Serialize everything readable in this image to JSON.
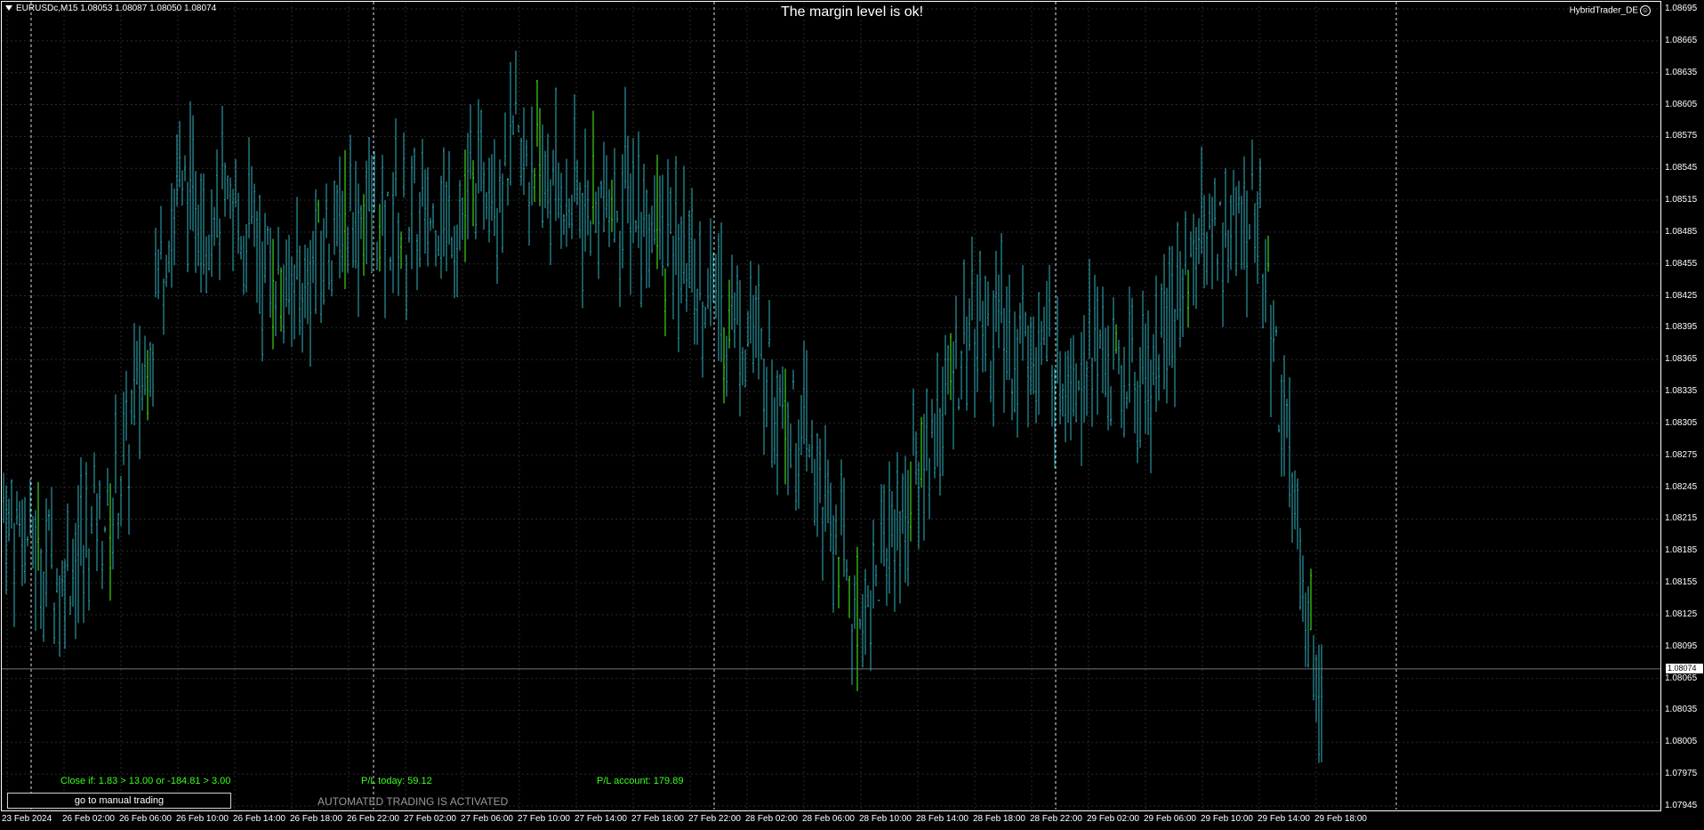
{
  "window": {
    "symbol_info": "EURUSDc,M15  1.08053 1.08087 1.08050 1.08074",
    "margin_message": "The margin level is ok!",
    "ea_name": "HybridTrader_DE"
  },
  "panel": {
    "close_if": "Close if: 1.83 > 13.00 or -184.81 > 3.00",
    "pl_today": "P/L today:  59.12",
    "pl_account": "P/L account:  179.89",
    "manual_button_label": "go to manual trading",
    "automated_status": "AUTOMATED TRADING IS ACTIVATED"
  },
  "colors": {
    "background": "#000000",
    "bar": "#2fb3c0",
    "bar_up": "#4cff1a",
    "grid": "#2a2a2a",
    "separator": "#e0e0e0",
    "axis": "#ffffff",
    "status_text": "#3cff1f"
  },
  "chart_data": {
    "type": "bar",
    "symbol": "EURUSDc",
    "timeframe": "M15",
    "current_price": "1.08074",
    "ylim": [
      1.07945,
      1.08695
    ],
    "y_ticks": [
      "1.08695",
      "1.08665",
      "1.08635",
      "1.08605",
      "1.08575",
      "1.08545",
      "1.08515",
      "1.08485",
      "1.08455",
      "1.08425",
      "1.08395",
      "1.08365",
      "1.08335",
      "1.08305",
      "1.08275",
      "1.08245",
      "1.08215",
      "1.08185",
      "1.08155",
      "1.08125",
      "1.08095",
      "1.08065",
      "1.08035",
      "1.08005",
      "1.07975",
      "1.07945"
    ],
    "x_ticks": [
      "23 Feb 2024",
      "26 Feb 02:00",
      "26 Feb 06:00",
      "26 Feb 10:00",
      "26 Feb 14:00",
      "26 Feb 18:00",
      "26 Feb 22:00",
      "27 Feb 02:00",
      "27 Feb 06:00",
      "27 Feb 10:00",
      "27 Feb 14:00",
      "27 Feb 18:00",
      "27 Feb 22:00",
      "28 Feb 02:00",
      "28 Feb 06:00",
      "28 Feb 10:00",
      "28 Feb 14:00",
      "28 Feb 18:00",
      "28 Feb 22:00",
      "29 Feb 02:00",
      "29 Feb 06:00",
      "29 Feb 10:00",
      "29 Feb 14:00",
      "29 Feb 18:00"
    ],
    "day_separators": [
      "26 Feb 00:00",
      "26 Feb 24:00",
      "27 Feb 24:00",
      "28 Feb 24:00",
      "29 Feb 24:00"
    ],
    "series": [
      {
        "x": [
          "23 Feb 2024",
          "26 Feb 02:00",
          "26 Feb 06:00",
          "26 Feb 10:00",
          "26 Feb 14:00",
          "26 Feb 18:00",
          "26 Feb 22:00",
          "27 Feb 02:00",
          "27 Feb 06:00",
          "27 Feb 10:00",
          "27 Feb 14:00",
          "27 Feb 18:00",
          "27 Feb 22:00",
          "28 Feb 02:00",
          "28 Feb 06:00",
          "28 Feb 10:00",
          "28 Feb 14:00",
          "28 Feb 18:00",
          "28 Feb 22:00",
          "29 Feb 02:00",
          "29 Feb 06:00",
          "29 Feb 10:00",
          "29 Feb 14:00",
          "29 Feb 18:00"
        ],
        "values": [
          1.0822,
          1.0816,
          1.0824,
          1.0852,
          1.085,
          1.0843,
          1.085,
          1.0849,
          1.0851,
          1.0856,
          1.0851,
          1.0852,
          1.0845,
          1.084,
          1.083,
          1.0812,
          1.0825,
          1.084,
          1.0837,
          1.0837,
          1.0834,
          1.0848,
          1.085,
          1.0807
        ]
      }
    ]
  }
}
